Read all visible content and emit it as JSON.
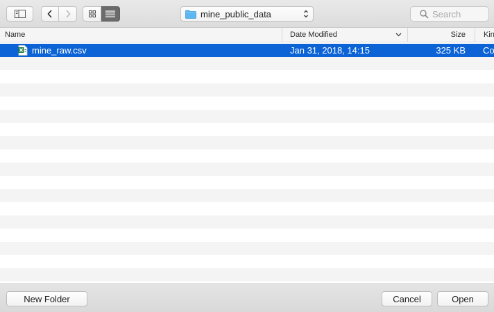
{
  "toolbar": {
    "sidebar_toggle_icon": "sidebar-icon",
    "back_icon": "chevron-left-icon",
    "forward_icon": "chevron-right-icon",
    "icon_view_icon": "grid-icon",
    "list_view_icon": "list-icon",
    "location": "mine_public_data",
    "location_icon": "folder-icon",
    "search_placeholder": "Search"
  },
  "columns": {
    "name": "Name",
    "date_modified": "Date Modified",
    "size": "Size",
    "kind": "Kind"
  },
  "files": [
    {
      "name": "mine_raw.csv",
      "icon": "excel-csv-icon",
      "date_modified": "Jan 31, 2018, 14:15",
      "size": "325 KB",
      "kind": "Co",
      "selected": true
    }
  ],
  "footer": {
    "new_folder": "New Folder",
    "cancel": "Cancel",
    "open": "Open"
  },
  "colors": {
    "selection": "#0b63d6",
    "folder": "#5bb8f0",
    "excel_green": "#1f7a3f"
  }
}
